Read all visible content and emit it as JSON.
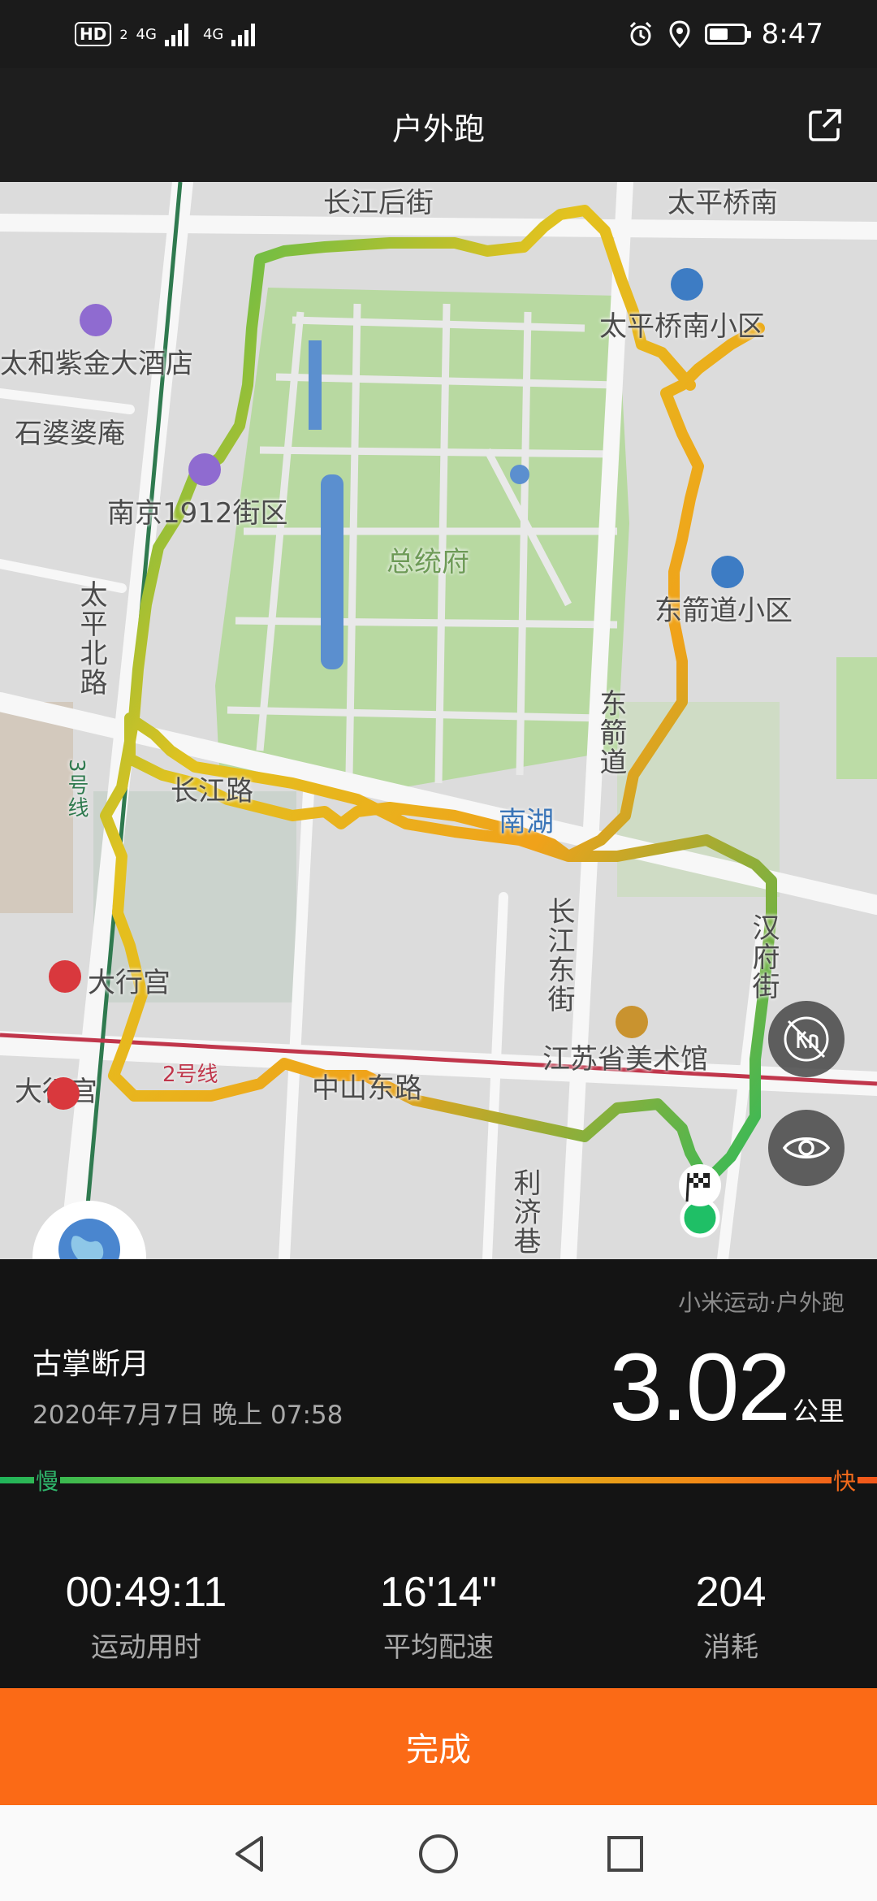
{
  "status_bar": {
    "time": "8:47",
    "network1": "4G",
    "network2": "4G",
    "hd_badge": "HD",
    "sim_badge": "2",
    "icons": [
      "alarm-icon",
      "location-icon",
      "battery-icon"
    ]
  },
  "header": {
    "title": "户外跑",
    "share_icon": "share-icon"
  },
  "map": {
    "labels": {
      "changjiang_hou": "长江后街",
      "taiping_qiao_nan": "太平桥南",
      "taiping_qiao_xiaoqu": "太平桥南小区",
      "hotel": "太和紫金大酒店",
      "shipopo": "石婆婆庵",
      "district_1912": "南京1912街区",
      "zongtongfu": "总统府",
      "dongjiandao_xiaoqu": "东箭道小区",
      "taiping_bei": "太平北路",
      "line3": "3号线",
      "dongjiandao": "东箭道",
      "nanhu": "南湖",
      "changjiang_frag": "长江路",
      "changjiang_dongjie": "长江东街",
      "daxinggong1": "大行宫",
      "daxinggong2": "大行宫",
      "museum": "江苏省美术馆",
      "line2": "2号线",
      "zhongshan": "中山东路",
      "liji": "利济巷",
      "hanfu_frag": "汉府街"
    },
    "brand_colors": {
      "slow": "#1fb45a",
      "mid": "#e7c21b",
      "fast": "#f26a1b"
    }
  },
  "summary": {
    "source": "小米运动·户外跑",
    "username": "古掌断月",
    "datetime": "2020年7月7日 晚上 07:58",
    "distance_value": "3.02",
    "distance_unit": "公里",
    "pace_slow_label": "慢",
    "pace_fast_label": "快"
  },
  "stats": [
    {
      "value": "00:49:11",
      "label": "运动用时"
    },
    {
      "value": "16'14\"",
      "label": "平均配速"
    },
    {
      "value": "204",
      "label": "消耗"
    }
  ],
  "actions": {
    "finish_label": "完成"
  },
  "nav": {
    "icons": [
      "back-icon",
      "home-icon",
      "recents-icon"
    ]
  }
}
